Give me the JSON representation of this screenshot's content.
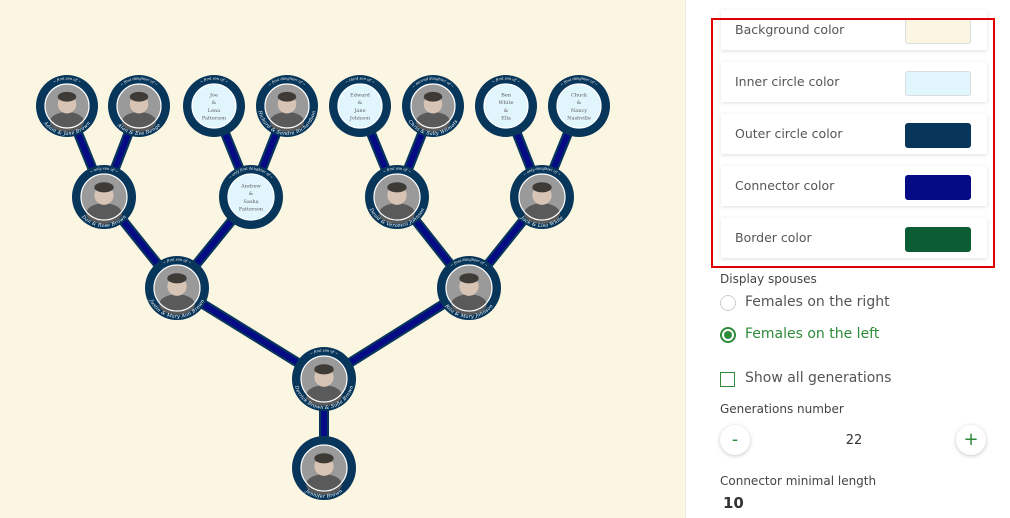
{
  "colors": {
    "background": "#faf6e2",
    "inner_circle": "#e1f5fd",
    "outer_circle": "#08365a",
    "connector": "#050a85",
    "border": "#0b5c35",
    "accent": "#2e8b3a",
    "highlight": "#e00000"
  },
  "panel": {
    "color_settings": [
      {
        "label": "Background color",
        "value": "#faf6e2"
      },
      {
        "label": "Inner circle color",
        "value": "#e1f5fd"
      },
      {
        "label": "Outer circle color",
        "value": "#08365a"
      },
      {
        "label": "Connector color",
        "value": "#050a85"
      },
      {
        "label": "Border color",
        "value": "#0b5c35"
      }
    ],
    "display_spouses_label": "Display spouses",
    "spouse_options": [
      {
        "label": "Females on the right",
        "selected": false
      },
      {
        "label": "Females on the left",
        "selected": true
      }
    ],
    "show_all_label": "Show all generations",
    "show_all_checked": false,
    "generations_label": "Generations number",
    "generations_minus": "-",
    "generations_plus": "+",
    "generations_value": "22",
    "connector_label": "Connector minimal length",
    "connector_value": "10"
  },
  "tree": {
    "nodes": [
      {
        "id": "gp1",
        "name": "Adam & Jane Brown",
        "top_text": "~ first son of ~",
        "photo": true
      },
      {
        "id": "gp2",
        "name": "Alan & Eve Renge",
        "top_text": "~ first daughter of ~",
        "photo": true
      },
      {
        "id": "gp3",
        "name": "",
        "top_text": "~ first son of ~",
        "photo": false,
        "inner_lines": [
          "Joe",
          "&",
          "Lena",
          "Patterson"
        ]
      },
      {
        "id": "gp4",
        "name": "Richard & Sandra Richardson",
        "top_text": "~ first daughter of ~",
        "photo": true
      },
      {
        "id": "gp5",
        "name": "",
        "top_text": "~ third son of ~",
        "photo": false,
        "inner_lines": [
          "Edward",
          "&",
          "Jane",
          "Johnson"
        ]
      },
      {
        "id": "gp6",
        "name": "Chris & Sally Wilmots",
        "top_text": "~ second daughter of ~",
        "photo": true
      },
      {
        "id": "gp7",
        "name": "",
        "top_text": "~ first son of ~",
        "photo": false,
        "inner_lines": [
          "Ben",
          "White",
          "&",
          "Ella"
        ]
      },
      {
        "id": "gp8",
        "name": "",
        "top_text": "~ first daughter of ~",
        "photo": false,
        "inner_lines": [
          "Chuck",
          "&",
          "Nancy",
          "Nashville"
        ]
      },
      {
        "id": "p1",
        "name": "Dan & Rose Brown",
        "top_text": "~ only son of ~",
        "photo": true
      },
      {
        "id": "p2",
        "name": "",
        "top_text": "~ only first daughter of ~",
        "photo": false,
        "inner_lines": [
          "Andrew",
          "&",
          "Sasha",
          "Patterson"
        ]
      },
      {
        "id": "p3",
        "name": "David & Veronica Johnson",
        "top_text": "~ first son of ~",
        "photo": true
      },
      {
        "id": "p4",
        "name": "Jack & Lisa White",
        "top_text": "~ only daughter of ~",
        "photo": true
      },
      {
        "id": "c1",
        "name": "Justin & Mary Ann Brown",
        "top_text": "~ first son of ~",
        "photo": true
      },
      {
        "id": "c2",
        "name": "Rita & Mary Johnson",
        "top_text": "~ first daughter of ~",
        "photo": true
      },
      {
        "id": "root",
        "name": "Derrick Brown & Sofia Brown",
        "top_text": "~ first son of ~",
        "photo": true
      },
      {
        "id": "child",
        "name": "Jennifer Brown",
        "top_text": "",
        "photo": true
      }
    ]
  }
}
